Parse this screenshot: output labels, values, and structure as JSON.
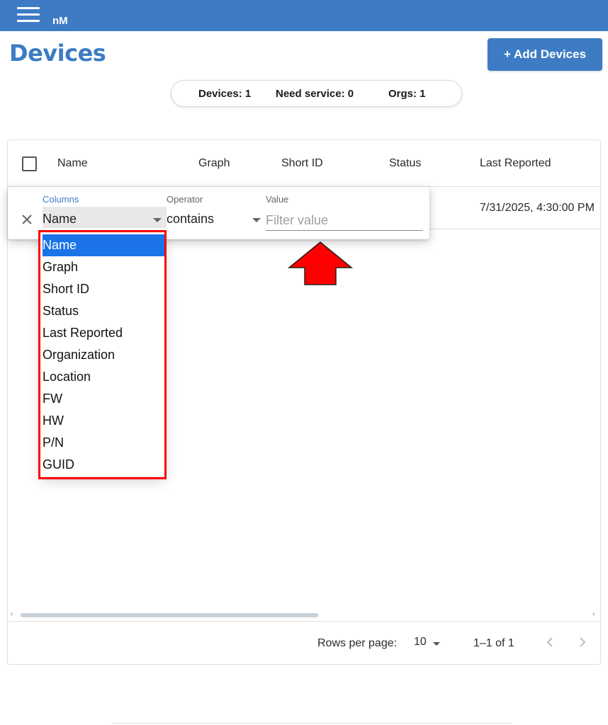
{
  "appbar": {
    "logo": "nM"
  },
  "header": {
    "title": "Devices",
    "add_button": "+ Add Devices"
  },
  "summary": {
    "devices": "Devices: 1",
    "need_service": "Need service: 0",
    "orgs": "Orgs: 1"
  },
  "grid": {
    "columns": [
      "Name",
      "Graph",
      "Short ID",
      "Status",
      "Last Reported"
    ],
    "rows": [
      {
        "last_reported": "7/31/2025, 4:30:00 PM"
      }
    ]
  },
  "filter": {
    "columns_label": "Columns",
    "operator_label": "Operator",
    "value_label": "Value",
    "column_value": "Name",
    "operator_value": "contains",
    "value_placeholder": "Filter value",
    "options": [
      "Name",
      "Graph",
      "Short ID",
      "Status",
      "Last Reported",
      "Organization",
      "Location",
      "FW",
      "HW",
      "P/N",
      "GUID"
    ],
    "selected_option": "Name"
  },
  "footer": {
    "rows_per_page_label": "Rows per page:",
    "rows_per_page_value": "10",
    "range": "1–1 of 1"
  },
  "colors": {
    "brand": "#3d7cc4",
    "selected_option": "#1a73e8",
    "annotation": "#ff0000"
  }
}
